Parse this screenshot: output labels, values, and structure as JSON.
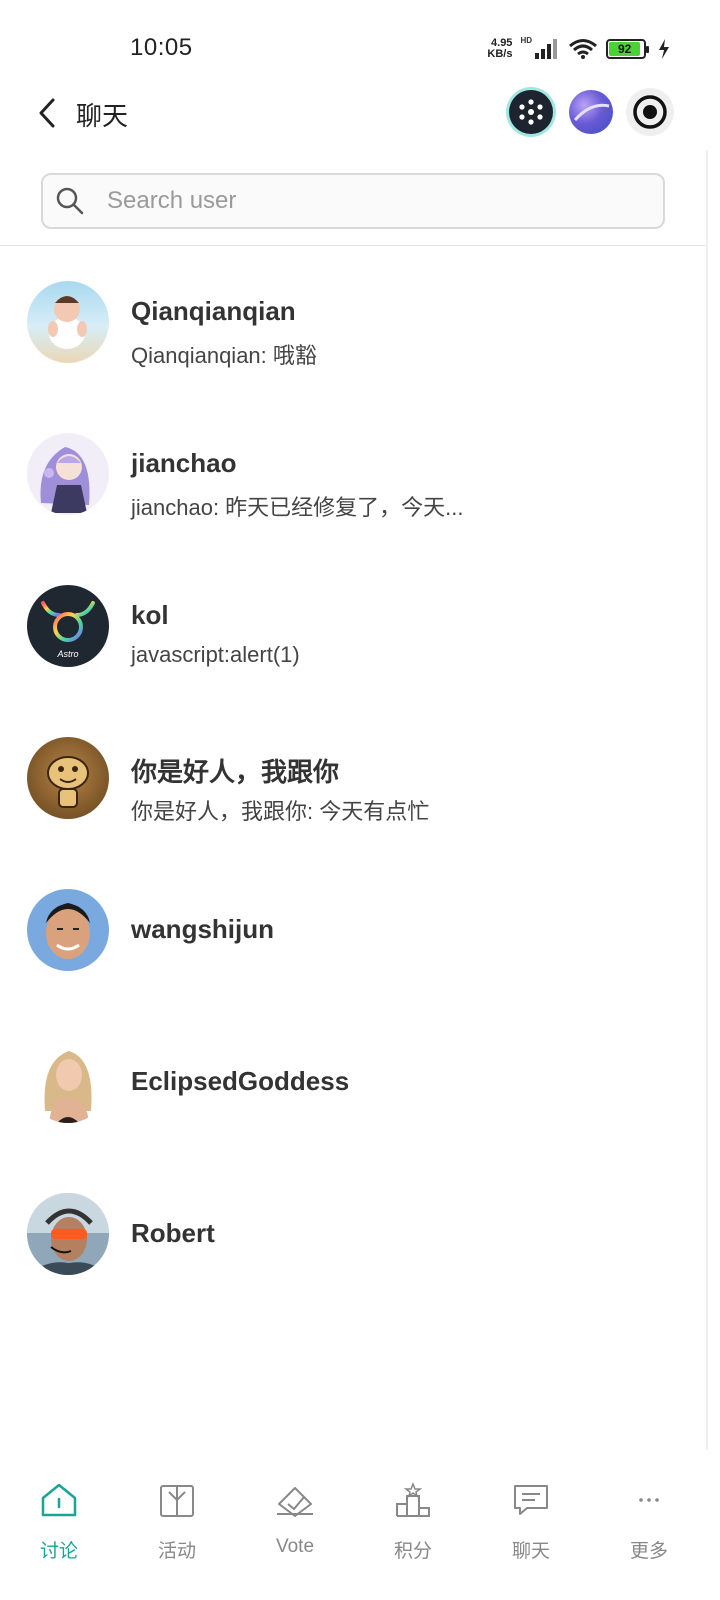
{
  "status_bar": {
    "time": "10:05",
    "net_speed_value": "4.95",
    "net_speed_unit": "KB/s",
    "hd_label": "HD",
    "battery_level": "92",
    "icons": [
      "signal-icon",
      "wifi-icon",
      "battery-icon",
      "charging-icon"
    ]
  },
  "header": {
    "title": "聊天",
    "icons": [
      "back-icon",
      "dots-app-icon",
      "planet-app-icon",
      "record-icon"
    ]
  },
  "search": {
    "placeholder": "Search user",
    "value": ""
  },
  "chats": [
    {
      "name": "Qianqianqian",
      "preview": "Qianqianqian: 哦豁",
      "avatar_color": "#bfe2ef"
    },
    {
      "name": "jianchao",
      "preview": "jianchao: 昨天已经修复了，今天...",
      "avatar_color": "#e9e4f4"
    },
    {
      "name": "kol",
      "preview": "javascript:alert(1)",
      "avatar_color": "#1f2730",
      "avatar_text": "Astro"
    },
    {
      "name": "你是好人，我跟你",
      "preview": "你是好人，我跟你: 今天有点忙",
      "avatar_color": "#7a5528"
    },
    {
      "name": "wangshijun",
      "preview": "",
      "avatar_color": "#7aa9e0"
    },
    {
      "name": "EclipsedGoddess",
      "preview": "",
      "avatar_color": "#d6b49a"
    },
    {
      "name": "Robert",
      "preview": "",
      "avatar_color": "#8fa7b8"
    }
  ],
  "nav": {
    "items": [
      {
        "label": "讨论",
        "icon": "home-icon",
        "active": true
      },
      {
        "label": "活动",
        "icon": "gift-icon",
        "active": false
      },
      {
        "label": "Vote",
        "icon": "vote-icon",
        "active": false
      },
      {
        "label": "积分",
        "icon": "podium-icon",
        "active": false
      },
      {
        "label": "聊天",
        "icon": "chat-icon",
        "active": false
      },
      {
        "label": "更多",
        "icon": "more-icon",
        "active": false
      }
    ]
  },
  "colors": {
    "accent": "#1aa396",
    "text_primary": "#333333",
    "nav_inactive": "#888888",
    "battery_fill": "#4cd137"
  }
}
